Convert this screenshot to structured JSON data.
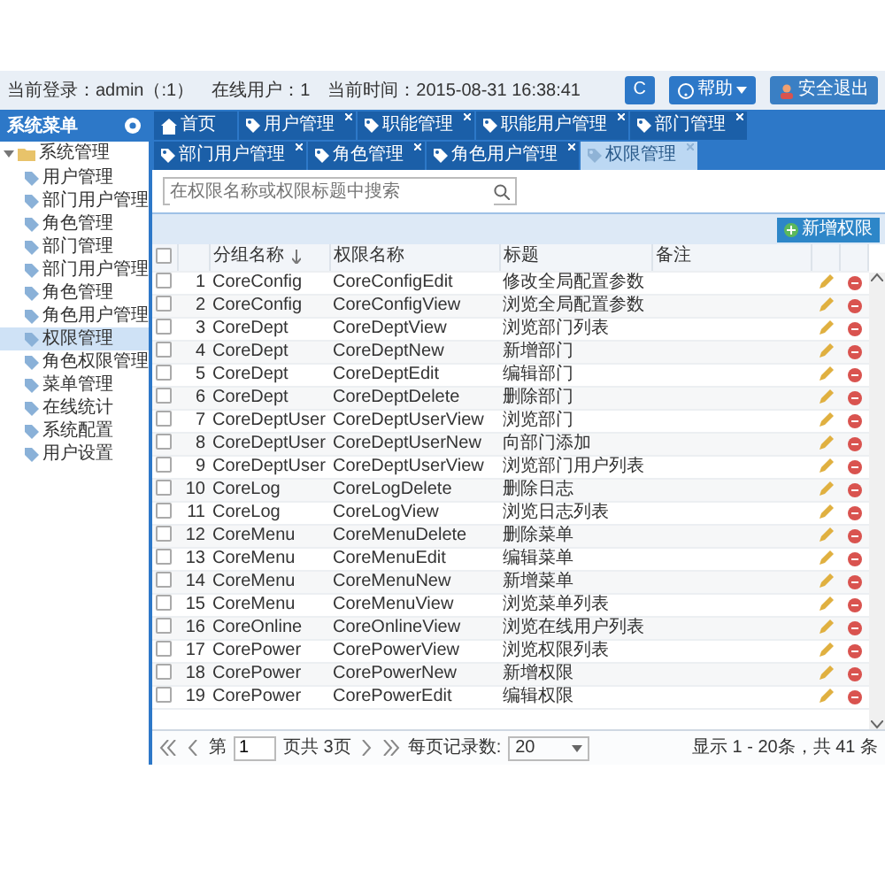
{
  "top_bar": {
    "login": "当前登录：admin（:1）",
    "online": "在线用户：1",
    "time": "当前时间：2015-08-31 16:38:41",
    "buttons": [
      {
        "kind": "refresh",
        "label": "C"
      },
      {
        "kind": "dropdown",
        "label": "帮助"
      },
      {
        "kind": "logout",
        "label": "安全退出"
      }
    ]
  },
  "sidebar": {
    "title": "系统菜单",
    "tree": [
      {
        "label": "系统管理",
        "expanded": true,
        "children": [
          {
            "label": "用户管理",
            "selected": false
          },
          {
            "label": "部门用户管理",
            "selected": false
          },
          {
            "label": "角色管理",
            "selected": false
          },
          {
            "label": "部门管理",
            "selected": false
          },
          {
            "label": "部门用户管理",
            "selected": false
          },
          {
            "label": "角色管理",
            "selected": false
          },
          {
            "label": "角色用户管理",
            "selected": false
          },
          {
            "label": "权限管理",
            "selected": true
          },
          {
            "label": "角色权限管理",
            "selected": false
          },
          {
            "label": "菜单管理",
            "selected": false
          },
          {
            "label": "在线统计",
            "selected": false
          },
          {
            "label": "系统配置",
            "selected": false
          },
          {
            "label": "用户设置",
            "selected": false
          }
        ]
      }
    ]
  },
  "tabs": [
    {
      "kind": "home",
      "label": "首页",
      "selected": false
    },
    {
      "kind": "page",
      "label": "用户管理",
      "selected": false
    },
    {
      "kind": "page",
      "label": "职能管理",
      "selected": false
    },
    {
      "kind": "page",
      "label": "职能用户管理",
      "selected": false
    },
    {
      "kind": "page",
      "label": "部门管理",
      "selected": false
    },
    {
      "kind": "page",
      "label": "部门用户管理",
      "selected": false
    },
    {
      "kind": "page",
      "label": "角色管理",
      "selected": false
    },
    {
      "kind": "page",
      "label": "角色用户管理",
      "selected": false
    },
    {
      "kind": "page",
      "label": "权限管理",
      "selected": true
    }
  ],
  "search": {
    "placeholder": "在权限名称或权限标题中搜索"
  },
  "add_button": "新增权限",
  "table": {
    "header_checked": false,
    "columns": [
      {
        "label": "分组名称",
        "sorted": true
      },
      {
        "label": "权限名称",
        "sorted": false
      },
      {
        "label": "标题",
        "sorted": false
      },
      {
        "label": "备注",
        "sorted": false
      }
    ],
    "rows": [
      {
        "no": "1",
        "group": "CoreConfig",
        "name": "CoreConfigEdit",
        "title": "修改全局配置参数",
        "checked": false
      },
      {
        "no": "2",
        "group": "CoreConfig",
        "name": "CoreConfigView",
        "title": "浏览全局配置参数",
        "checked": false
      },
      {
        "no": "3",
        "group": "CoreDept",
        "name": "CoreDeptView",
        "title": "浏览部门列表",
        "checked": false
      },
      {
        "no": "4",
        "group": "CoreDept",
        "name": "CoreDeptNew",
        "title": "新增部门",
        "checked": false
      },
      {
        "no": "5",
        "group": "CoreDept",
        "name": "CoreDeptEdit",
        "title": "编辑部门",
        "checked": false
      },
      {
        "no": "6",
        "group": "CoreDept",
        "name": "CoreDeptDelete",
        "title": "删除部门",
        "checked": false
      },
      {
        "no": "7",
        "group": "CoreDeptUser",
        "name": "CoreDeptUserView",
        "title": "浏览部门",
        "checked": false
      },
      {
        "no": "8",
        "group": "CoreDeptUser",
        "name": "CoreDeptUserNew",
        "title": "向部门添加",
        "checked": false
      },
      {
        "no": "9",
        "group": "CoreDeptUser",
        "name": "CoreDeptUserView",
        "title": "浏览部门用户列表",
        "checked": false
      },
      {
        "no": "10",
        "group": "CoreLog",
        "name": "CoreLogDelete",
        "title": "删除日志",
        "checked": false
      },
      {
        "no": "11",
        "group": "CoreLog",
        "name": "CoreLogView",
        "title": "浏览日志列表",
        "checked": false
      },
      {
        "no": "12",
        "group": "CoreMenu",
        "name": "CoreMenuDelete",
        "title": "删除菜单",
        "checked": false
      },
      {
        "no": "13",
        "group": "CoreMenu",
        "name": "CoreMenuEdit",
        "title": "编辑菜单",
        "checked": false
      },
      {
        "no": "14",
        "group": "CoreMenu",
        "name": "CoreMenuNew",
        "title": "新增菜单",
        "checked": false
      },
      {
        "no": "15",
        "group": "CoreMenu",
        "name": "CoreMenuView",
        "title": "浏览菜单列表",
        "checked": false
      },
      {
        "no": "16",
        "group": "CoreOnline",
        "name": "CoreOnlineView",
        "title": "浏览在线用户列表",
        "checked": false
      },
      {
        "no": "17",
        "group": "CorePower",
        "name": "CorePowerView",
        "title": "浏览权限列表",
        "checked": false
      },
      {
        "no": "18",
        "group": "CorePower",
        "name": "CorePowerNew",
        "title": "新增权限",
        "checked": false
      },
      {
        "no": "19",
        "group": "CorePower",
        "name": "CorePowerEdit",
        "title": "编辑权限",
        "checked": false
      }
    ]
  },
  "pager": {
    "page_prefix": "第",
    "page": "1",
    "page_suffix": "页共 3页",
    "size_label": "每页记录数:",
    "size": "20",
    "summary": "显示 1 - 20条，共 41 条"
  }
}
